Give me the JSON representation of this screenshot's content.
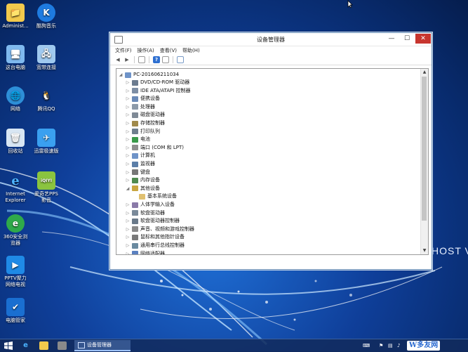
{
  "desktop": {
    "icons": [
      {
        "label": "Administ...",
        "glyph": "📁"
      },
      {
        "label": "酷狗音乐",
        "glyph": "K"
      },
      {
        "label": "这台电脑",
        "glyph": "🖥"
      },
      {
        "label": "宽带连接",
        "glyph": "🖧"
      },
      {
        "label": "网络",
        "glyph": "🌐"
      },
      {
        "label": "腾讯QQ",
        "glyph": "🐧"
      },
      {
        "label": "回收站",
        "glyph": "🗑"
      },
      {
        "label": "迅雷极速版",
        "glyph": "✈"
      },
      {
        "label": "Internet Explorer",
        "glyph": "e"
      },
      {
        "label": "爱奇艺PPS 影音",
        "glyph": "iQIYI"
      },
      {
        "label": "360安全浏览器",
        "glyph": "e"
      },
      {
        "label": "PPTV聚力 网络电视",
        "glyph": "▶"
      },
      {
        "label": "电脑管家",
        "glyph": "✔"
      }
    ],
    "background_text": "HOST V"
  },
  "window": {
    "title": "设备管理器",
    "controls": {
      "minimize": "—",
      "maximize": "☐",
      "close": "✕"
    },
    "menu": [
      "文件(F)",
      "操作(A)",
      "查看(V)",
      "帮助(H)"
    ],
    "tree": {
      "root": "PC-201606211034",
      "items": [
        {
          "label": "DVD/CD-ROM 驱动器",
          "expanded": false
        },
        {
          "label": "IDE ATA/ATAPI 控制器",
          "expanded": false
        },
        {
          "label": "便携设备",
          "expanded": false
        },
        {
          "label": "处理器",
          "expanded": false
        },
        {
          "label": "磁盘驱动器",
          "expanded": false
        },
        {
          "label": "存储控制器",
          "expanded": false
        },
        {
          "label": "打印队列",
          "expanded": false
        },
        {
          "label": "电池",
          "expanded": false
        },
        {
          "label": "端口 (COM 和 LPT)",
          "expanded": false
        },
        {
          "label": "计算机",
          "expanded": false
        },
        {
          "label": "监视器",
          "expanded": false
        },
        {
          "label": "键盘",
          "expanded": false
        },
        {
          "label": "内存设备",
          "expanded": false
        },
        {
          "label": "其他设备",
          "expanded": true
        },
        {
          "label": "基本系统设备",
          "child": true
        },
        {
          "label": "人体学输入设备",
          "expanded": false
        },
        {
          "label": "软盘驱动器",
          "expanded": false
        },
        {
          "label": "软盘驱动器控制器",
          "expanded": false
        },
        {
          "label": "声音、视频和游戏控制器",
          "expanded": false
        },
        {
          "label": "鼠标和其他指针设备",
          "expanded": false
        },
        {
          "label": "通用串行总线控制器",
          "expanded": false
        },
        {
          "label": "网络适配器",
          "expanded": false
        }
      ]
    }
  },
  "taskbar": {
    "active_task": "设备管理器",
    "brand": "W多友网"
  },
  "colors": {
    "accent": "#2a6ad1",
    "close": "#c7352e"
  }
}
